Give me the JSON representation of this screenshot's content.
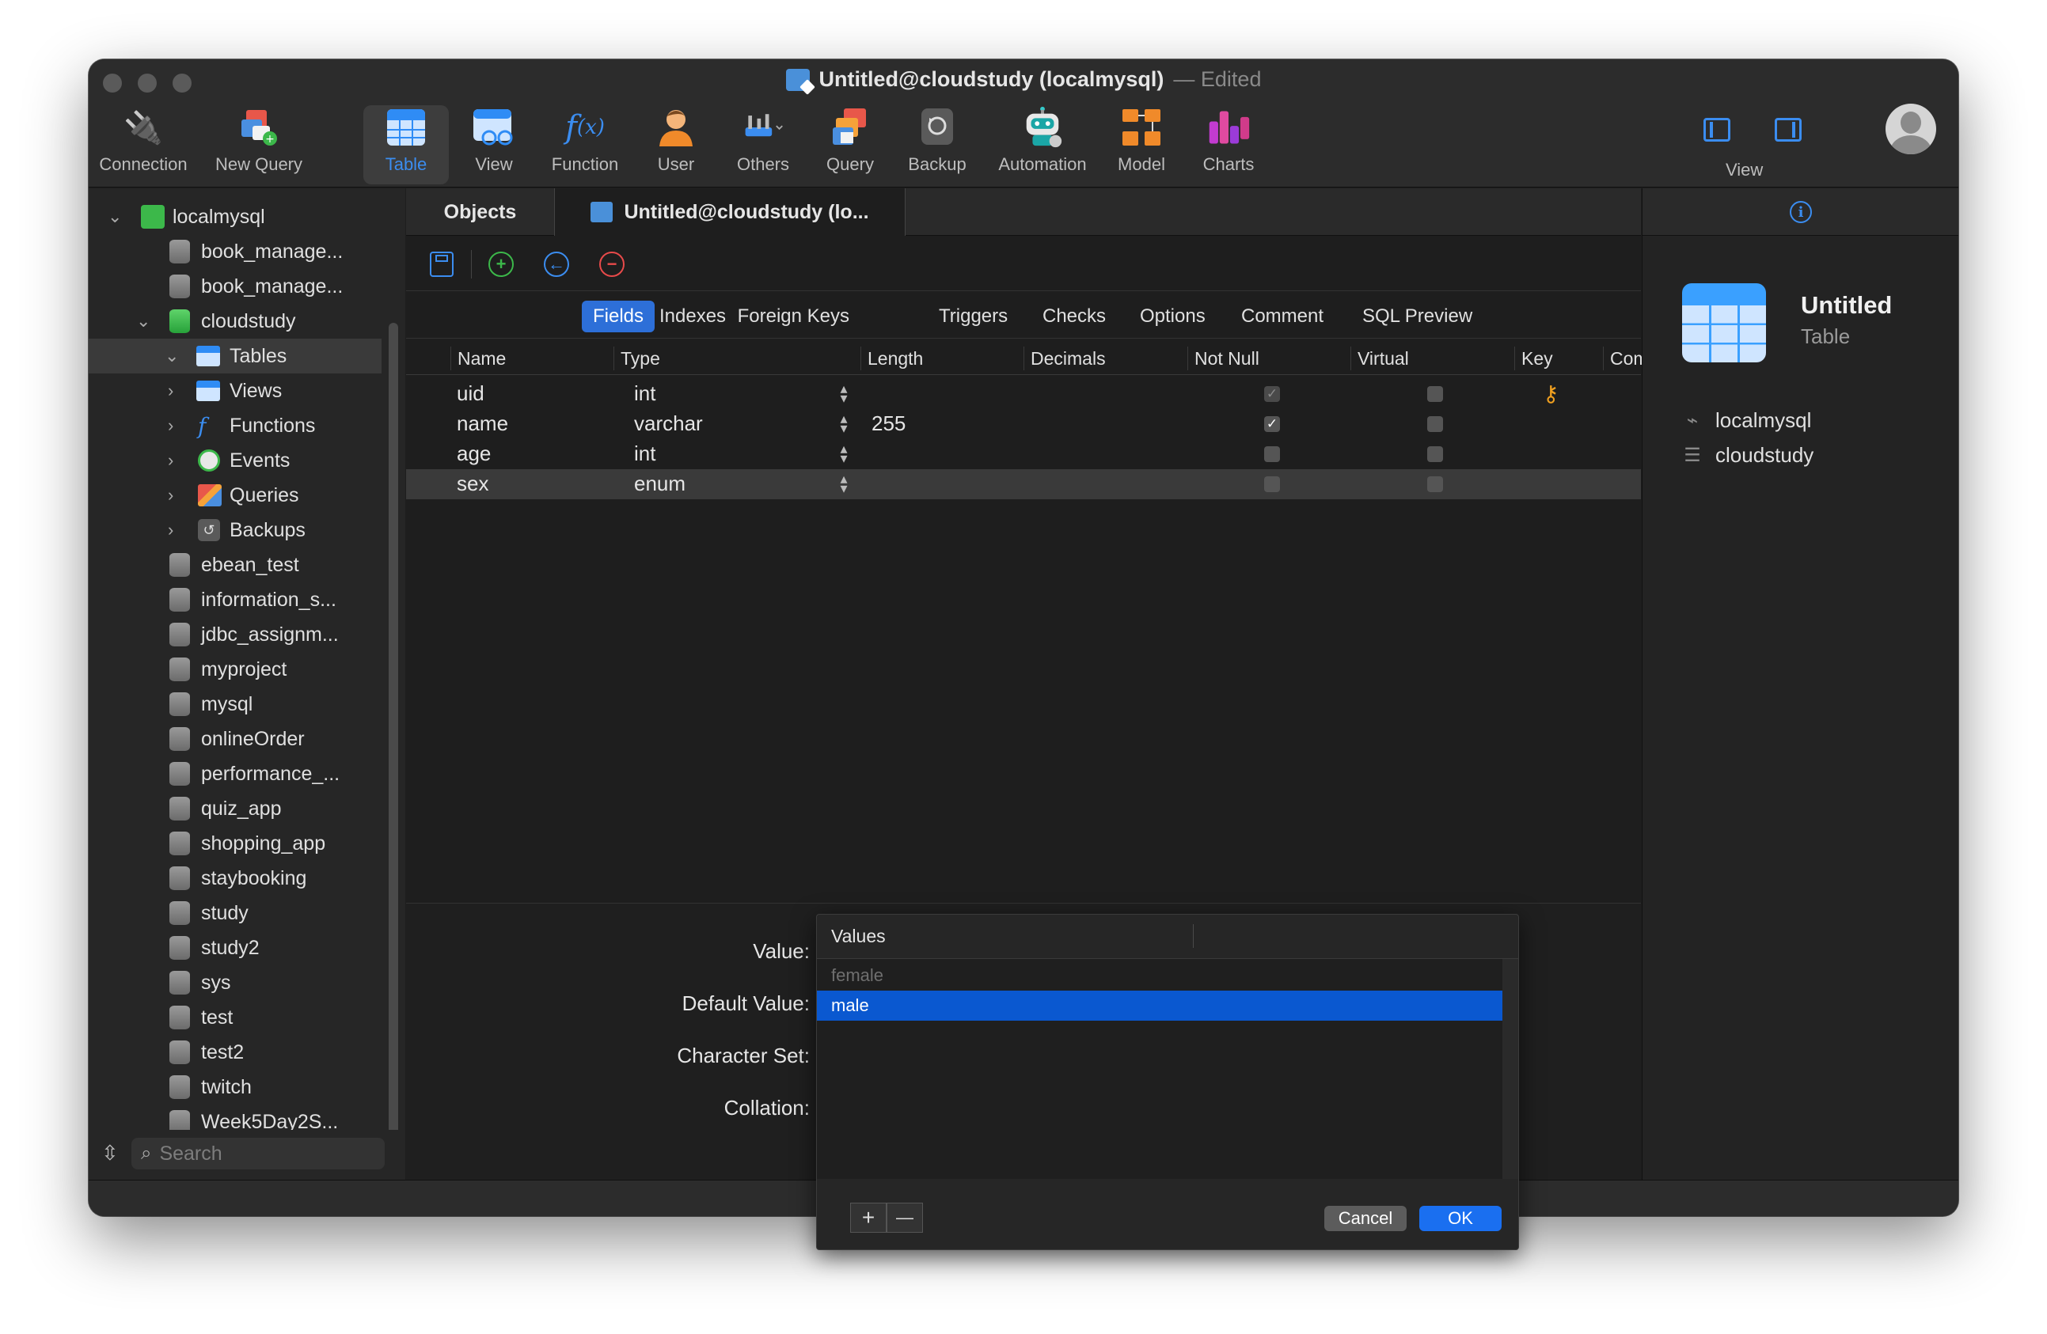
{
  "window": {
    "title": "Untitled@cloudstudy (localmysql)",
    "title_suffix": "— Edited"
  },
  "toolbar": {
    "items": [
      {
        "label": "Connection",
        "icon": "plug-icon"
      },
      {
        "label": "New Query",
        "icon": "new-query-icon"
      },
      {
        "label": "Table",
        "icon": "table-icon",
        "active": true
      },
      {
        "label": "View",
        "icon": "view-icon"
      },
      {
        "label": "Function",
        "icon": "function-icon"
      },
      {
        "label": "User",
        "icon": "user-icon"
      },
      {
        "label": "Others",
        "icon": "others-icon"
      },
      {
        "label": "Query",
        "icon": "query-icon"
      },
      {
        "label": "Backup",
        "icon": "backup-icon"
      },
      {
        "label": "Automation",
        "icon": "robot-icon"
      },
      {
        "label": "Model",
        "icon": "model-icon"
      },
      {
        "label": "Charts",
        "icon": "charts-icon"
      }
    ],
    "view_label": "View"
  },
  "sidebar": {
    "connection": "localmysql",
    "databases_before": [
      "book_manage...",
      "book_manage..."
    ],
    "open_db": "cloudstudy",
    "open_db_children": [
      "Tables",
      "Views",
      "Functions",
      "Events",
      "Queries",
      "Backups"
    ],
    "databases_after": [
      "ebean_test",
      "information_s...",
      "jdbc_assignm...",
      "myproject",
      "mysql",
      "onlineOrder",
      "performance_...",
      "quiz_app",
      "shopping_app",
      "staybooking",
      "study",
      "study2",
      "sys",
      "test",
      "test2",
      "twitch",
      "Week5Day2S..."
    ],
    "search_placeholder": "Search"
  },
  "tabs": [
    {
      "label": "Objects"
    },
    {
      "label": "Untitled@cloudstudy (lo...",
      "active": true
    }
  ],
  "subtabs": [
    "Fields",
    "Indexes",
    "Foreign Keys",
    "Triggers",
    "Checks",
    "Options",
    "Comment",
    "SQL Preview"
  ],
  "active_subtab": "Fields",
  "grid": {
    "columns": [
      "Name",
      "Type",
      "Length",
      "Decimals",
      "Not Null",
      "Virtual",
      "Key",
      "Comment"
    ],
    "rows": [
      {
        "name": "uid",
        "type": "int",
        "length": "",
        "decimals": "",
        "not_null": true,
        "not_null_disabled": true,
        "virtual": false,
        "key": true,
        "comment": ""
      },
      {
        "name": "name",
        "type": "varchar",
        "length": "255",
        "decimals": "",
        "not_null": true,
        "virtual": false,
        "key": false,
        "comment": ""
      },
      {
        "name": "age",
        "type": "int",
        "length": "",
        "decimals": "",
        "not_null": false,
        "virtual": false,
        "key": false,
        "comment": ""
      },
      {
        "name": "sex",
        "type": "enum",
        "length": "",
        "decimals": "",
        "not_null": false,
        "virtual": false,
        "key": false,
        "comment": "",
        "selected": true
      }
    ]
  },
  "properties": {
    "value_label": "Value:",
    "value": "female",
    "default_label": "Default Value:",
    "charset_label": "Character Set:",
    "collation_label": "Collation:",
    "more_button": "..."
  },
  "popup": {
    "header": "Values",
    "items": [
      {
        "label": "female",
        "dim": true
      },
      {
        "label": "male",
        "selected": true
      }
    ],
    "add": "+",
    "remove": "—",
    "cancel": "Cancel",
    "ok": "OK"
  },
  "right_panel": {
    "name": "Untitled",
    "type": "Table",
    "connection": "localmysql",
    "database": "cloudstudy"
  }
}
